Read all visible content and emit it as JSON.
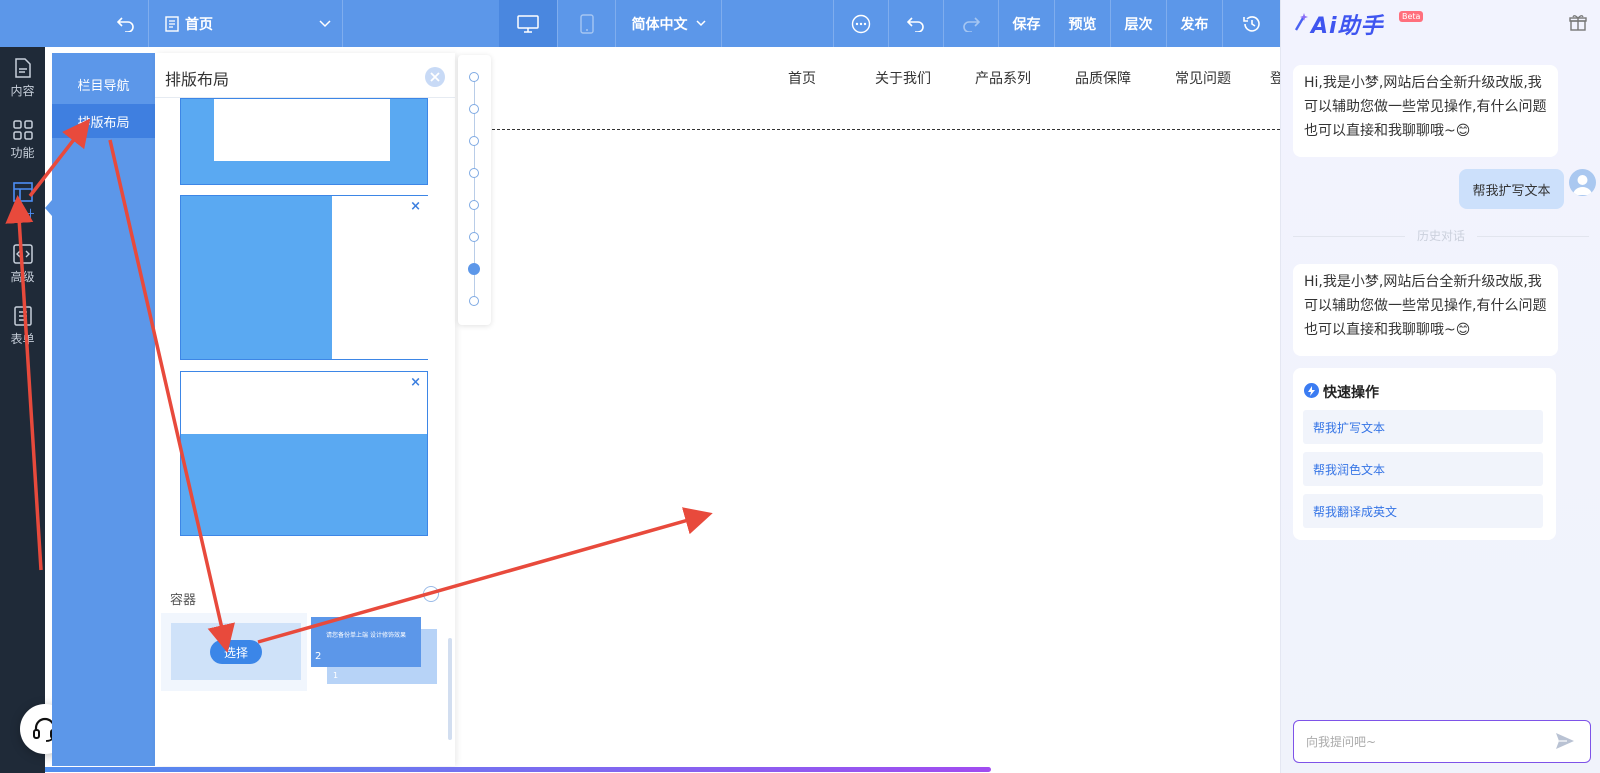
{
  "toolbar": {
    "page_name": "首页",
    "language": "简体中文",
    "save": "保存",
    "preview": "预览",
    "layers": "层次",
    "publish": "发布"
  },
  "rail": {
    "items": [
      {
        "label": "内容",
        "icon": "document-icon"
      },
      {
        "label": "功能",
        "icon": "grid-icon"
      },
      {
        "label": "设计",
        "icon": "layout-icon"
      },
      {
        "label": "高级",
        "icon": "code-icon"
      },
      {
        "label": "表单",
        "icon": "form-icon"
      }
    ]
  },
  "subnav": {
    "items": [
      {
        "label": "栏目导航"
      },
      {
        "label": "排版布局"
      }
    ]
  },
  "panel": {
    "title": "排版布局",
    "close_glyph": "×",
    "remove_glyph": "×",
    "section_label": "容器",
    "select_label": "选择",
    "card2_text": "请您备份单上端\n设计修饰效果",
    "card2_num": "2",
    "card2_num_back": "1"
  },
  "stepper": {
    "count": 8,
    "active_index": 6
  },
  "site": {
    "nav": [
      "首页",
      "关于我们",
      "产品系列",
      "品质保障",
      "常见问题",
      "登"
    ]
  },
  "assistant": {
    "logo": "Ai助手",
    "badge": "Beta",
    "greeting": "Hi,我是小梦,网站后台全新升级改版,我可以辅助您做一些常见操作,有什么问题也可以直接和我聊聊哦~",
    "emoji": "😊",
    "user_message": "帮我扩写文本",
    "history_label": "历史对话",
    "quick_title": "快速操作",
    "quick_actions": [
      "帮我扩写文本",
      "帮我润色文本",
      "帮我翻译成英文"
    ],
    "input_placeholder": "向我提问吧~"
  },
  "colors": {
    "toolbar": "#5c97e9",
    "rail": "#1f2a38",
    "accent": "#3b86e8",
    "annotation_arrow": "#e84a3c",
    "assistant_logo": "#3f55f0"
  }
}
